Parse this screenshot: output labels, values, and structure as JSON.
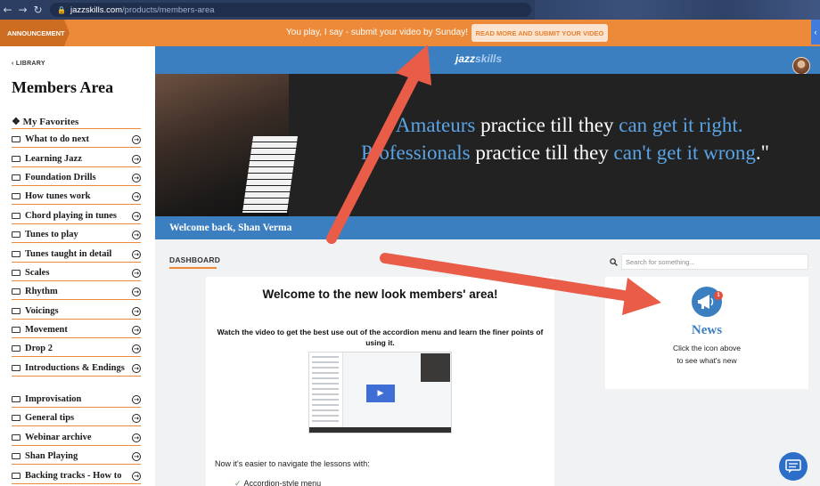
{
  "browser": {
    "back": "←",
    "forward": "→",
    "reload": "↻",
    "url_host": "jazzskills.com",
    "url_path": "/products/members-area"
  },
  "announcement": {
    "tag": "ANNOUNCEMENT",
    "text": "You play, I say - submit your video by Sunday!",
    "button": "READ MORE AND SUBMIT YOUR VIDEO",
    "side_icon": "‹"
  },
  "sidebar": {
    "back_label": "LIBRARY",
    "title": "Members Area",
    "favorites": "❖ My Favorites",
    "items": [
      {
        "label": "What to do next"
      },
      {
        "label": "Learning Jazz"
      },
      {
        "label": "Foundation Drills"
      },
      {
        "label": "How tunes work"
      },
      {
        "label": "Chord playing in tunes"
      },
      {
        "label": "Tunes to play"
      },
      {
        "label": "Tunes taught in detail"
      },
      {
        "label": "Scales"
      },
      {
        "label": "Rhythm"
      },
      {
        "label": "Voicings"
      },
      {
        "label": "Movement"
      },
      {
        "label": "Drop 2"
      },
      {
        "label": "Introductions & Endings"
      },
      {
        "label": "Improvisation"
      },
      {
        "label": "General tips"
      },
      {
        "label": "Webinar archive"
      },
      {
        "label": "Shan Playing"
      },
      {
        "label": "Backing tracks - How to"
      }
    ]
  },
  "header": {
    "logo_jazz": "jazz",
    "logo_skills": "skills"
  },
  "hero": {
    "q_open": "\"",
    "q1": "Amateurs",
    "q2": " practice till they ",
    "q3": "can get it right.",
    "q4": "Professionals",
    "q5": " practice till they ",
    "q6": "can't get it wrong",
    "q7": ".\""
  },
  "welcome": "Welcome back, Shan Verma",
  "dashboard": {
    "tab": "DASHBOARD",
    "card_title": "Welcome to the new look members' area!",
    "card_sub": "Watch the video to get the best use out of the accordion menu and learn the finer points of using it.",
    "play_icon": "▶",
    "note": "Now it's easier to navigate the lessons with:",
    "check_item": "Accordion-style menu"
  },
  "search": {
    "placeholder": "Search for something..."
  },
  "news": {
    "badge": "1",
    "title": "News",
    "line1": "Click the icon above",
    "line2": "to see what's new"
  },
  "colors": {
    "orange": "#ec8a39",
    "blue": "#3c7fc1",
    "arrow": "#e85c48"
  }
}
